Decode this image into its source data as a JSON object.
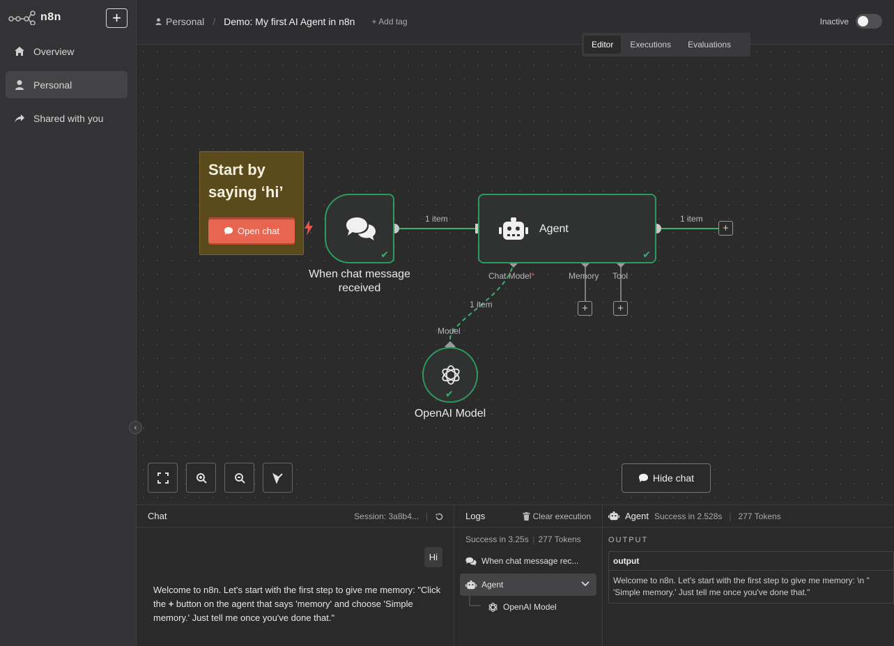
{
  "sidebar": {
    "logo": "n8n",
    "new_button": "+",
    "items": [
      {
        "label": "Overview",
        "icon": "home-icon"
      },
      {
        "label": "Personal",
        "icon": "user-icon"
      },
      {
        "label": "Shared with you",
        "icon": "share-icon"
      }
    ]
  },
  "header": {
    "project": "Personal",
    "workflow_title": "Demo: My first AI Agent in n8n",
    "add_tag": "+ Add tag",
    "status": "Inactive",
    "tabs": [
      {
        "label": "Editor"
      },
      {
        "label": "Executions"
      },
      {
        "label": "Evaluations"
      }
    ]
  },
  "canvas": {
    "sticky": {
      "title": "Start by saying ‘hi’",
      "button": "Open chat"
    },
    "nodes": {
      "trigger": {
        "label": "When chat message received"
      },
      "agent": {
        "label": "Agent"
      },
      "model": {
        "label": "OpenAI Model"
      }
    },
    "connections": {
      "trigger_to_agent": "1 item",
      "agent_out": "1 item",
      "model_to_agent": "1 item"
    },
    "ports": {
      "chat_model": "Chat Model",
      "chat_model_required": "*",
      "memory": "Memory",
      "tool": "Tool",
      "model": "Model"
    },
    "hide_chat": "Hide chat"
  },
  "chat": {
    "title": "Chat",
    "session": "Session: 3a8b4...",
    "user_message": "Hi",
    "bot_message": {
      "part1": "Welcome to n8n. Let's start with the first step to give me memory: \"Click the ",
      "bold": "+",
      "part2": " button on the agent that says 'memory' and choose 'Simple memory.' Just tell me once you've done that.\""
    }
  },
  "logs": {
    "title": "Logs",
    "clear": "Clear execution",
    "stat_time": "Success in 3.25s",
    "stat_tokens": "277 Tokens",
    "items": [
      {
        "label": "When chat message rec..."
      },
      {
        "label": "Agent"
      },
      {
        "label": "OpenAI Model"
      }
    ]
  },
  "output": {
    "node": "Agent",
    "status": "Success in 2.528s",
    "tokens": "277 Tokens",
    "section": "OUTPUT",
    "column": "output",
    "value_line1": "Welcome to n8n. Let's start with the first step to give me memory: \\n \"",
    "value_line2": "'Simple memory.' Just tell me once you've done that.\""
  },
  "colors": {
    "accent_green": "#2e9b5e",
    "sticky_bg": "#5a4a1c",
    "open_chat": "#e8654f"
  }
}
